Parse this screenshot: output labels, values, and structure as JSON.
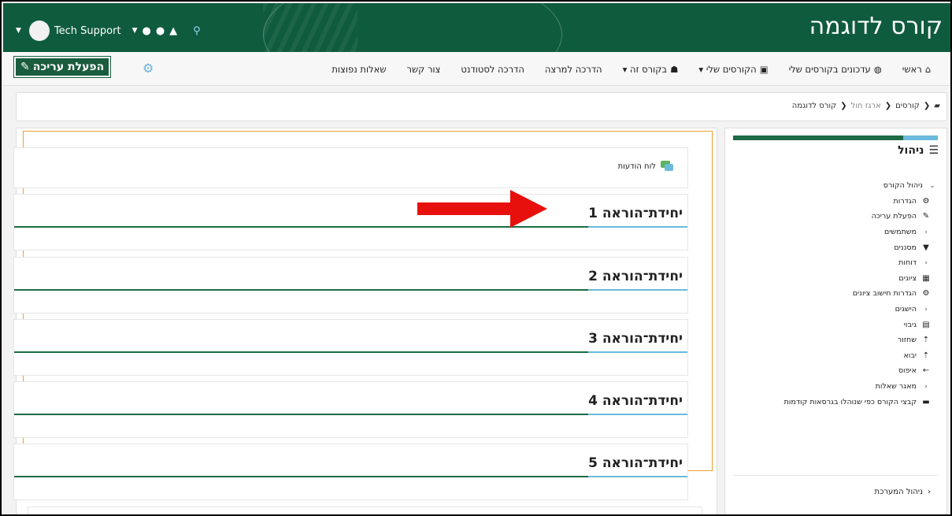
{
  "header": {
    "site_title": "קורס לדוגמה",
    "user_name": "Tech Support"
  },
  "nav": {
    "home": "ראשי",
    "my_course_updates": "עדכונים בקורסים שלי",
    "my_courses": "הקורסים שלי",
    "this_course": "בקורס זה",
    "lecturer_guide": "הדרכה למרצה",
    "student_guide": "הדרכה לסטודנט",
    "contact": "צור קשר",
    "faq": "שאלות נפוצות",
    "edit_mode": "הפעלת עריכה"
  },
  "breadcrumb": {
    "courses": "קורסים",
    "sandbox": "ארגז חול",
    "course": "קורס לדוגמה"
  },
  "main": {
    "forum": "לוח הודעות",
    "sections": [
      "יחידת־הוראה 1",
      "יחידת־הוראה 2",
      "יחידת־הוראה 3",
      "יחידת־הוראה 4",
      "יחידת־הוראה 5"
    ]
  },
  "sidebar": {
    "heading": "ניהול",
    "course_admin": "ניהול הקורס",
    "items": [
      "הגדרות",
      "הפעלת עריכה",
      "משתמשים",
      "מסננים",
      "דוחות",
      "ציונים",
      "הגדרות חישוב ציונים",
      "הישגים",
      "גיבוי",
      "שחזור",
      "יבוא",
      "איפוס",
      "מאגר שאלות",
      "קבצי הקורס כפי שנוהלו בגרסאות קודמות"
    ],
    "site_admin": "ניהול המערכת"
  },
  "colors": {
    "brand_green": "#0f5b3e",
    "accent_blue": "#6cbadc",
    "highlight_orange": "#f0a030",
    "arrow_red": "#e8100c"
  }
}
